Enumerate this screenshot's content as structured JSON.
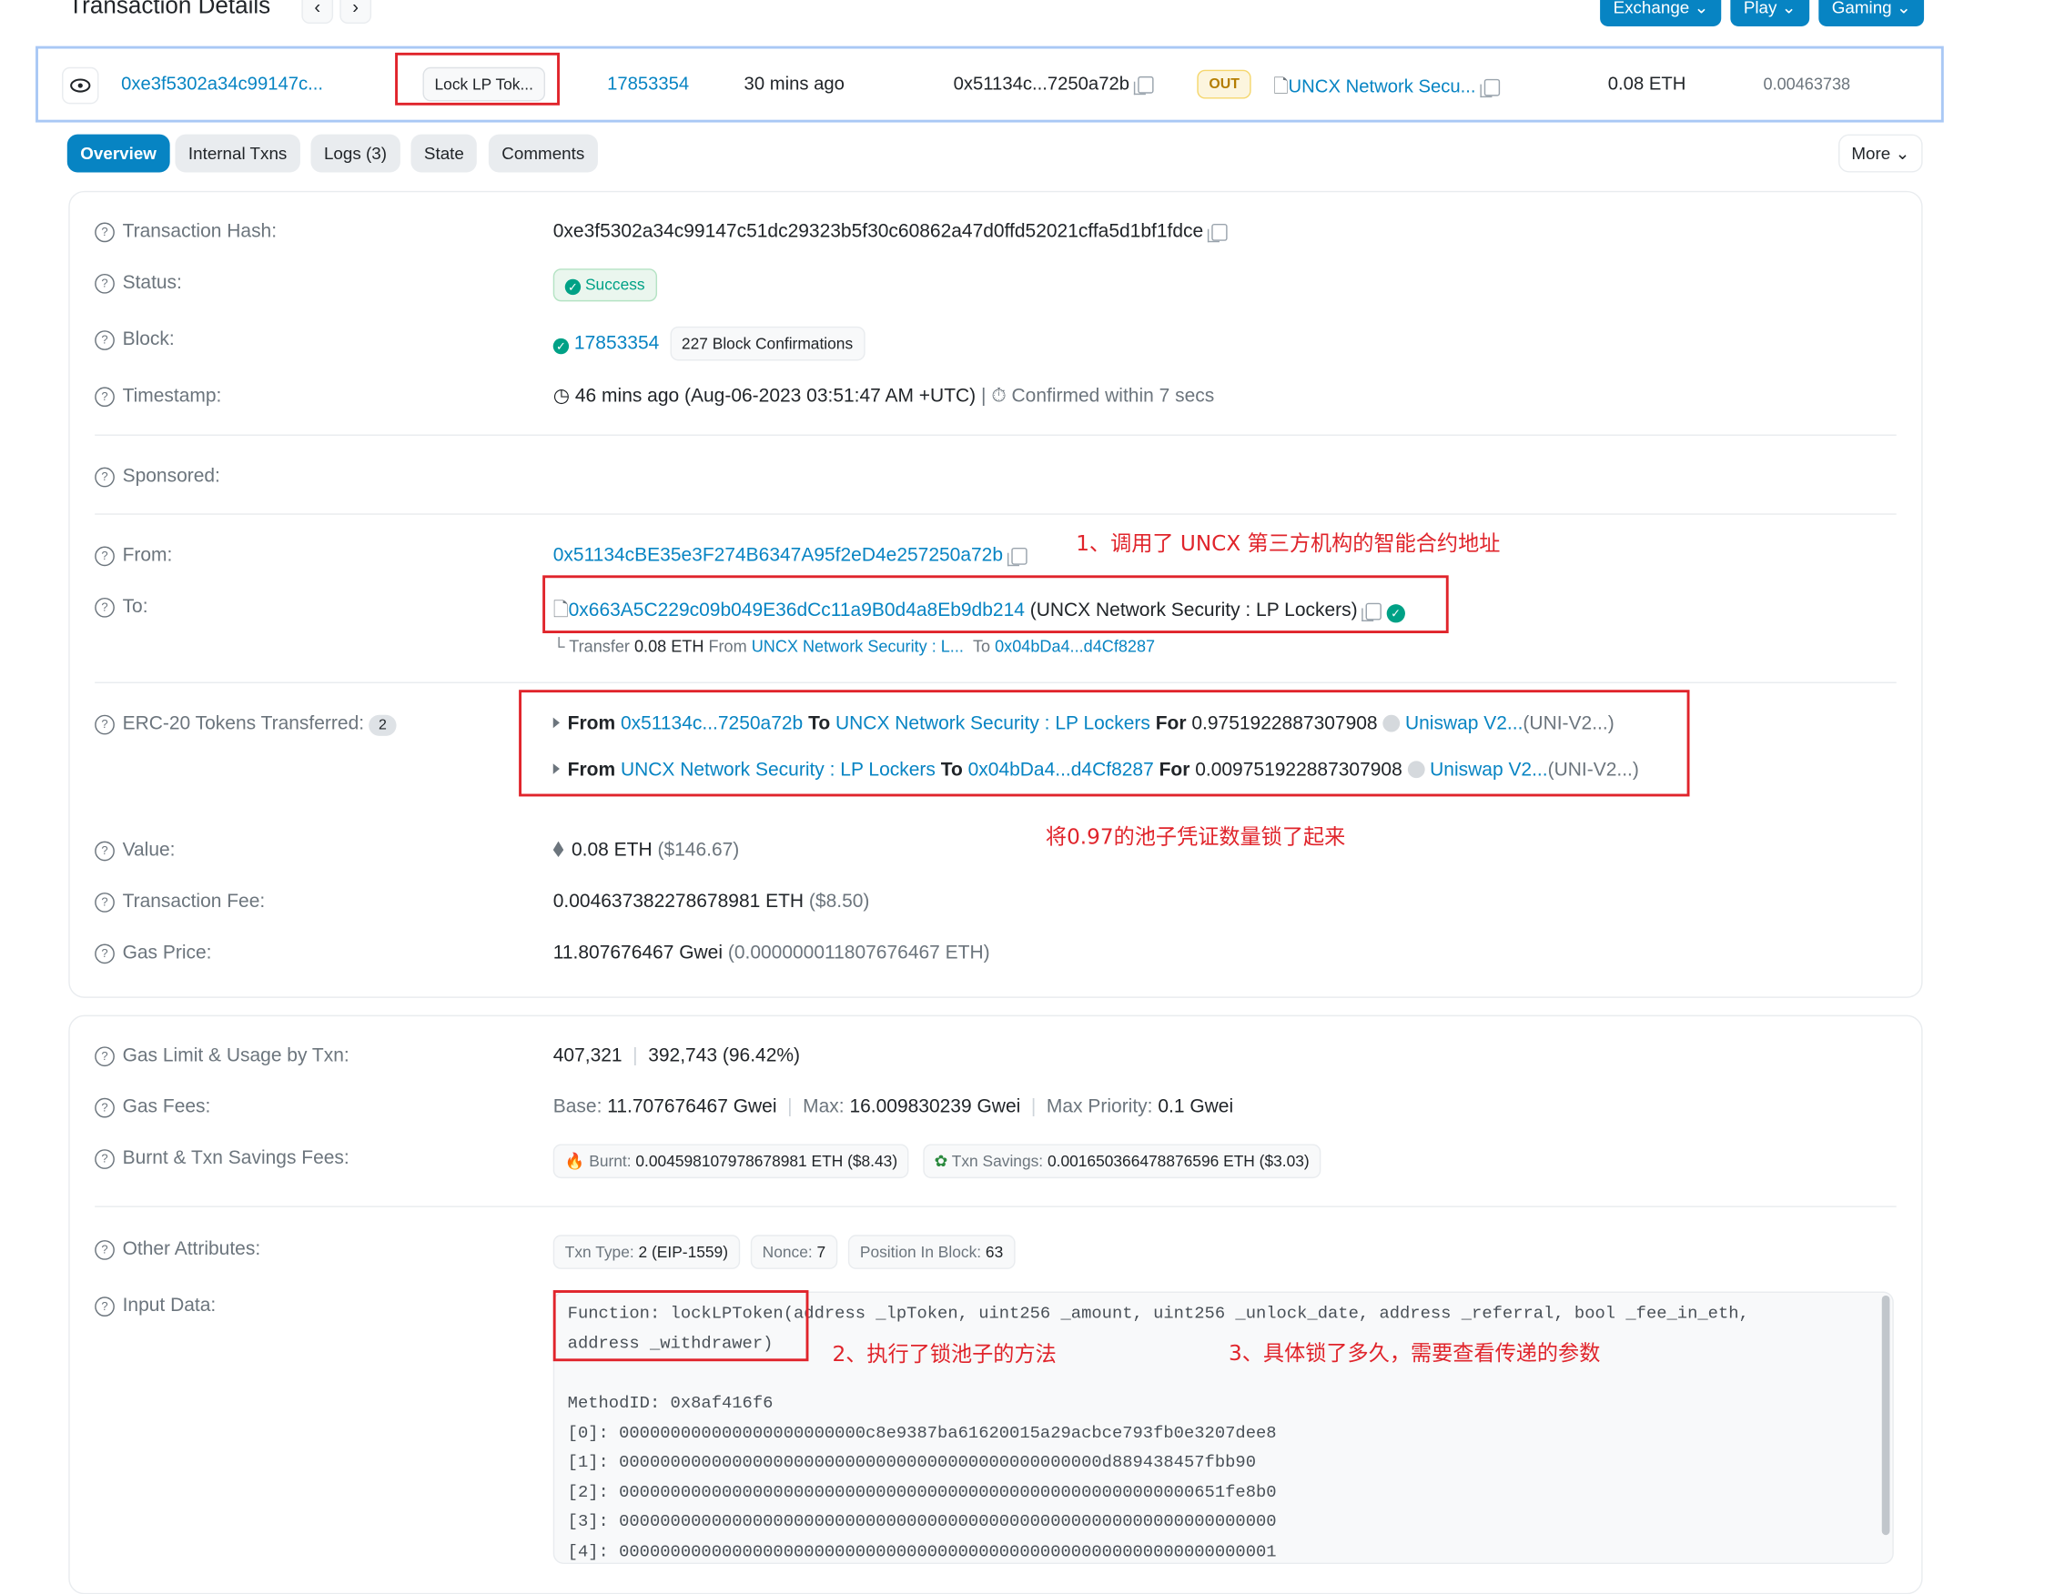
{
  "header": {
    "title": "Transaction Details",
    "prev": "‹",
    "next": "›",
    "buttons": [
      "Exchange",
      "Play",
      "Gaming"
    ]
  },
  "summary": {
    "hash": "0xe3f5302a34c99147c...",
    "method": "Lock LP Tok...",
    "block": "17853354",
    "age": "30 mins ago",
    "from": "0x51134c...7250a72b",
    "direction": "OUT",
    "to": "UNCX Network Secu...",
    "value": "0.08 ETH",
    "fee": "0.00463738"
  },
  "tabs": [
    "Overview",
    "Internal Txns",
    "Logs (3)",
    "State",
    "Comments"
  ],
  "more": "More",
  "details": {
    "hash_label": "Transaction Hash:",
    "hash": "0xe3f5302a34c99147c51dc29323b5f30c60862a47d0ffd52021cffa5d1bf1fdce",
    "status_label": "Status:",
    "status": "Success",
    "block_label": "Block:",
    "block": "17853354",
    "confirmations": "227 Block Confirmations",
    "timestamp_label": "Timestamp:",
    "timestamp": "46 mins ago (Aug-06-2023 03:51:47 AM +UTC)",
    "confirmed": "Confirmed within 7 secs",
    "sponsored_label": "Sponsored:",
    "from_label": "From:",
    "from": "0x51134cBE35e3F274B6347A95f2eD4e257250a72b",
    "to_label": "To:",
    "to_addr": "0x663A5C229c09b049E36dCc11a9B0d4a8Eb9db214",
    "to_name": "(UNCX Network Security : LP Lockers)",
    "internal": {
      "prefix": "└ Transfer",
      "amount": "0.08 ETH",
      "from_word": "From",
      "from": "UNCX Network Security : L...",
      "to_word": "To",
      "to": "0x04bDa4...d4Cf8287"
    },
    "erc20_label": "ERC-20 Tokens Transferred:",
    "erc20_count": "2",
    "transfers": [
      {
        "from_word": "From",
        "from": "0x51134c...7250a72b",
        "to_word": "To",
        "to": "UNCX Network Security : LP Lockers",
        "for_word": "For",
        "amount": "0.9751922887307908",
        "token": "Uniswap V2...",
        "symbol": "(UNI-V2...)"
      },
      {
        "from_word": "From",
        "from": "UNCX Network Security : LP Lockers",
        "to_word": "To",
        "to": "0x04bDa4...d4Cf8287",
        "for_word": "For",
        "amount": "0.009751922887307908",
        "token": "Uniswap V2...",
        "symbol": "(UNI-V2...)"
      }
    ],
    "value_label": "Value:",
    "value": "0.08 ETH",
    "value_usd": "($146.67)",
    "fee_label": "Transaction Fee:",
    "fee": "0.004637382278678981 ETH",
    "fee_usd": "($8.50)",
    "gasprice_label": "Gas Price:",
    "gasprice": "11.807676467 Gwei",
    "gasprice_eth": "(0.000000011807676467 ETH)"
  },
  "more_details": {
    "gaslimit_label": "Gas Limit & Usage by Txn:",
    "gaslimit": "407,321",
    "gasused": "392,743 (96.42%)",
    "gasfees_label": "Gas Fees:",
    "base_k": "Base:",
    "base": "11.707676467 Gwei",
    "max_k": "Max:",
    "max": "16.009830239 Gwei",
    "prio_k": "Max Priority:",
    "prio": "0.1 Gwei",
    "burnt_label": "Burnt & Txn Savings Fees:",
    "burnt_k": "Burnt:",
    "burnt": "0.004598107978678981 ETH ($8.43)",
    "savings_k": "Txn Savings:",
    "savings": "0.001650366478876596 ETH ($3.03)",
    "other_label": "Other Attributes:",
    "txtype_k": "Txn Type:",
    "txtype": "2 (EIP-1559)",
    "nonce_k": "Nonce:",
    "nonce": "7",
    "pos_k": "Position In Block:",
    "pos": "63",
    "input_label": "Input Data:",
    "input_lines": [
      "Function: lockLPToken(address _lpToken, uint256 _amount, uint256 _unlock_date, address _referral, bool _fee_in_eth,",
      "address _withdrawer)",
      "",
      "MethodID: 0x8af416f6",
      "[0]:  000000000000000000000000c8e9387ba61620015a29acbce793fb0e3207dee8",
      "[1]:  00000000000000000000000000000000000000000000000d889438457fbb90",
      "[2]:  00000000000000000000000000000000000000000000000000000000651fe8b0",
      "[3]:  0000000000000000000000000000000000000000000000000000000000000000",
      "[4]:  0000000000000000000000000000000000000000000000000000000000000001"
    ]
  },
  "annotations": {
    "a1": "1、调用了  UNCX 第三方机构的智能合约地址",
    "a2": "将0.97的池子凭证数量锁了起来",
    "a3": "2、执行了锁池子的方法",
    "a4": "3、具体锁了多久，需要查看传递的参数"
  }
}
